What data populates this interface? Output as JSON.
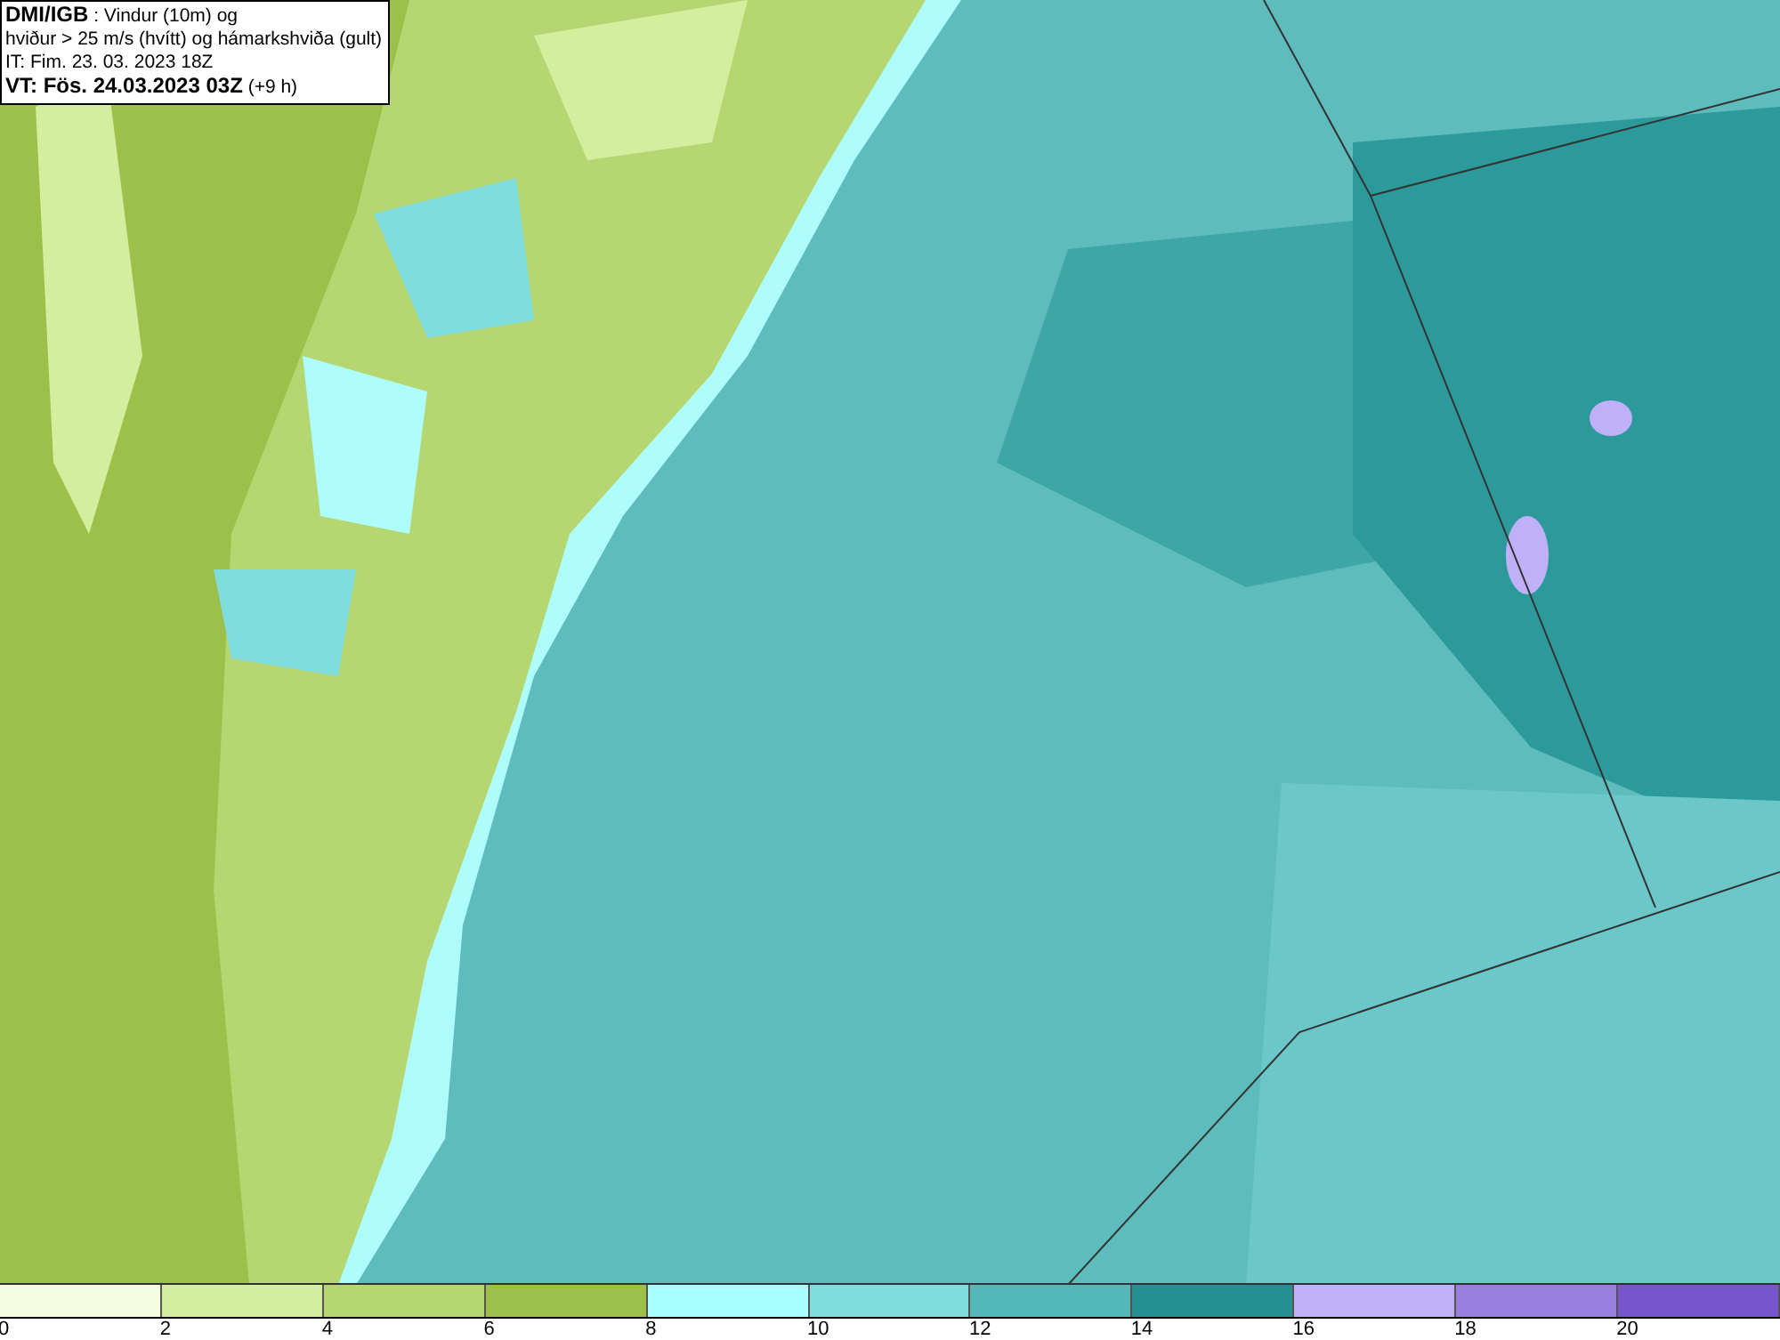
{
  "info_box": {
    "lines": [
      "**DMI/IGB** : Vindur (10m) og",
      "hviður > 25 m/s (hvítt) og hámarkshviða (gult)",
      "IT: Fim. 23. 03. 2023 18Z",
      "**VT: Fös. 24.03.2023 03Z** (+9 h)"
    ]
  },
  "legend": {
    "bins": [
      {
        "color": "#f5fde0"
      },
      {
        "color": "#d4eea0"
      },
      {
        "color": "#b5d670"
      },
      {
        "color": "#9cc04a"
      },
      {
        "color": "#aaffff"
      },
      {
        "color": "#80dddd"
      },
      {
        "color": "#55b8b8"
      },
      {
        "color": "#229090"
      },
      {
        "color": "#c0b0f8"
      },
      {
        "color": "#9980e0"
      },
      {
        "color": "#7755cc"
      }
    ],
    "ticks": [
      "0",
      "2",
      "4",
      "6",
      "8",
      "10",
      "12",
      "14",
      "16",
      "18",
      "20"
    ]
  }
}
